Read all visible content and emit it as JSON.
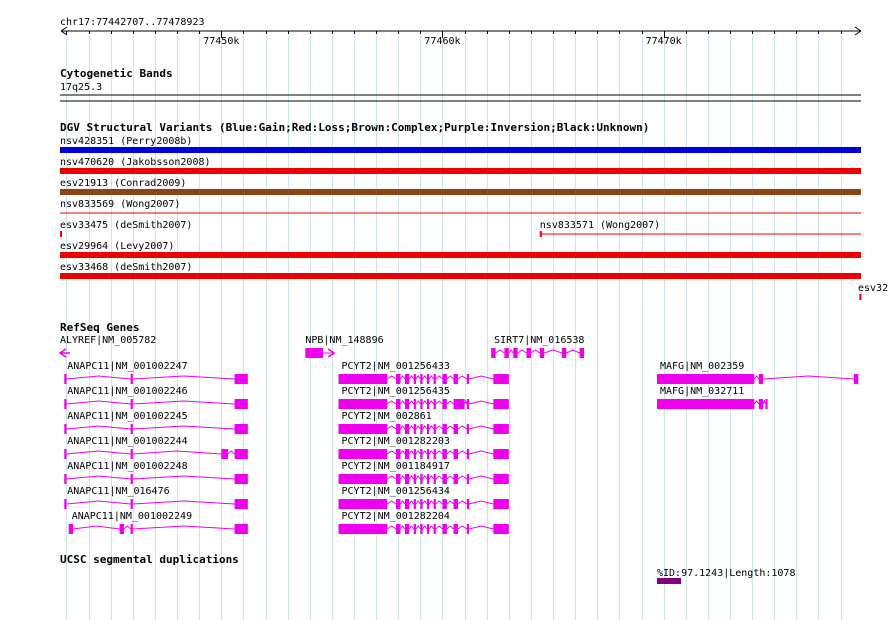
{
  "ruler": {
    "location": "chr17:77442707..77478923",
    "ticks": [
      {
        "pos": 77450000,
        "label": "77450k"
      },
      {
        "pos": 77460000,
        "label": "77460k"
      },
      {
        "pos": 77470000,
        "label": "77470k"
      }
    ],
    "minor_tick_step": 1000
  },
  "tracks": {
    "cytoband": {
      "title": "Cytogenetic Bands",
      "band": "17q25.3"
    },
    "dgv": {
      "title": "DGV Structural Variants (Blue:Gain;Red:Loss;Brown:Complex;Purple:Inversion;Black:Unknown)",
      "colors": {
        "gain": "#0000dd",
        "loss": "#ee0000",
        "complex": "#8b4513"
      },
      "features": [
        {
          "label": "nsv428351 (Perry2008b)",
          "type": "gain",
          "start": 77442707,
          "end": 77478923,
          "thick": true
        },
        {
          "label": "nsv470620 (Jakobsson2008)",
          "type": "loss",
          "start": 77442707,
          "end": 77478923,
          "thick": true
        },
        {
          "label": "esv21913 (Conrad2009)",
          "type": "complex",
          "start": 77442707,
          "end": 77478923,
          "thick": true
        },
        {
          "label": "nsv833569 (Wong2007)",
          "type": "loss",
          "start": 77442707,
          "end": 77478923,
          "thick": false
        },
        {
          "label": "esv33475 (deSmith2007)",
          "type": "loss",
          "start": 77442707,
          "end": 77442730,
          "thick": false,
          "tick": true
        },
        {
          "label": "nsv833571 (Wong2007)",
          "type": "loss",
          "start": 77464400,
          "end": 77478923,
          "thick": false
        },
        {
          "label": "esv29964 (Levy2007)",
          "type": "loss",
          "start": 77442707,
          "end": 77478923,
          "thick": true
        },
        {
          "label": "esv33468 (deSmith2007)",
          "type": "loss",
          "start": 77442707,
          "end": 77478923,
          "thick": true
        },
        {
          "label": "esv32",
          "type": "loss",
          "start": 77478850,
          "end": 77478923,
          "thick": false,
          "tick": true
        }
      ]
    },
    "refseq": {
      "title": "RefSeq Genes",
      "color": "#ee00ee",
      "genes": [
        {
          "label": "ALYREF|NM_005782",
          "start": 77442707,
          "end": 77442760,
          "strand": "-",
          "blocks": [],
          "arrow": true
        },
        {
          "label": "NPB|NM_148896",
          "start": 77453800,
          "end": 77455100,
          "strand": "+",
          "blocks": [
            [
              77453800,
              77454600
            ]
          ],
          "arrow": true
        },
        {
          "label": "SIRT7|NM_016538",
          "start": 77462200,
          "end": 77466400,
          "strand": "-",
          "blocks": [
            [
              77462200,
              77462400
            ],
            [
              77462800,
              77463000
            ],
            [
              77463200,
              77463400
            ],
            [
              77463800,
              77464000
            ],
            [
              77464400,
              77464600
            ],
            [
              77465400,
              77465600
            ],
            [
              77466200,
              77466400
            ]
          ]
        },
        {
          "label": "ANAPC11|NM_001002247",
          "start": 77442900,
          "end": 77451200,
          "strand": "+",
          "blocks": [
            [
              77442900,
              77443000
            ],
            [
              77445900,
              77446000
            ],
            [
              77450600,
              77451200
            ]
          ]
        },
        {
          "label": "ANAPC11|NM_001002246",
          "start": 77442900,
          "end": 77451200,
          "strand": "+",
          "blocks": [
            [
              77442900,
              77443000
            ],
            [
              77445900,
              77446000
            ],
            [
              77450600,
              77451200
            ]
          ]
        },
        {
          "label": "ANAPC11|NM_001002245",
          "start": 77442900,
          "end": 77451200,
          "strand": "+",
          "blocks": [
            [
              77442900,
              77443000
            ],
            [
              77445900,
              77446000
            ],
            [
              77450600,
              77451200
            ]
          ]
        },
        {
          "label": "ANAPC11|NM_001002244",
          "start": 77442900,
          "end": 77451200,
          "strand": "+",
          "blocks": [
            [
              77442900,
              77443000
            ],
            [
              77445900,
              77446000
            ],
            [
              77450000,
              77450300
            ],
            [
              77450600,
              77451200
            ]
          ]
        },
        {
          "label": "ANAPC11|NM_001002248",
          "start": 77442900,
          "end": 77451200,
          "strand": "+",
          "blocks": [
            [
              77442900,
              77443000
            ],
            [
              77445900,
              77446000
            ],
            [
              77450600,
              77451200
            ]
          ]
        },
        {
          "label": "ANAPC11|NM_016476",
          "start": 77442900,
          "end": 77451200,
          "strand": "+",
          "blocks": [
            [
              77442900,
              77443000
            ],
            [
              77445900,
              77446000
            ],
            [
              77450600,
              77451200
            ]
          ]
        },
        {
          "label": "ANAPC11|NM_001002249",
          "start": 77443100,
          "end": 77451200,
          "strand": "+",
          "blocks": [
            [
              77443100,
              77443300
            ],
            [
              77445400,
              77445600
            ],
            [
              77445900,
              77446000
            ],
            [
              77450600,
              77451200
            ]
          ]
        },
        {
          "label": "PCYT2|NM_001256433",
          "start": 77455300,
          "end": 77463000,
          "strand": "-",
          "blocks": [
            [
              77455300,
              77457500
            ],
            [
              77457900,
              77458100
            ],
            [
              77458300,
              77458500
            ],
            [
              77458700,
              77458800
            ],
            [
              77459000,
              77459100
            ],
            [
              77459300,
              77459400
            ],
            [
              77459600,
              77459700
            ],
            [
              77460000,
              77460200
            ],
            [
              77460500,
              77460700
            ],
            [
              77461100,
              77461200
            ],
            [
              77462300,
              77463000
            ]
          ]
        },
        {
          "label": "PCYT2|NM_001256435",
          "start": 77455300,
          "end": 77463000,
          "strand": "-",
          "blocks": [
            [
              77455300,
              77457500
            ],
            [
              77457900,
              77458100
            ],
            [
              77458300,
              77458500
            ],
            [
              77458700,
              77458800
            ],
            [
              77459000,
              77459100
            ],
            [
              77459300,
              77459400
            ],
            [
              77459600,
              77459700
            ],
            [
              77460000,
              77460200
            ],
            [
              77460500,
              77461000
            ],
            [
              77461100,
              77461200
            ],
            [
              77462300,
              77463000
            ]
          ]
        },
        {
          "label": "PCYT2|NM_002861",
          "start": 77455300,
          "end": 77463000,
          "strand": "-",
          "blocks": [
            [
              77455300,
              77457500
            ],
            [
              77457900,
              77458100
            ],
            [
              77458300,
              77458500
            ],
            [
              77458700,
              77458800
            ],
            [
              77459000,
              77459100
            ],
            [
              77459300,
              77459400
            ],
            [
              77459600,
              77459700
            ],
            [
              77460000,
              77460200
            ],
            [
              77460500,
              77460700
            ],
            [
              77461100,
              77461200
            ],
            [
              77462300,
              77463000
            ]
          ]
        },
        {
          "label": "PCYT2|NM_001282203",
          "start": 77455300,
          "end": 77463000,
          "strand": "-",
          "blocks": [
            [
              77455300,
              77457500
            ],
            [
              77457900,
              77458100
            ],
            [
              77458300,
              77458500
            ],
            [
              77458700,
              77458800
            ],
            [
              77459000,
              77459100
            ],
            [
              77459300,
              77459400
            ],
            [
              77459600,
              77459700
            ],
            [
              77460000,
              77460200
            ],
            [
              77460500,
              77460700
            ],
            [
              77461100,
              77461200
            ],
            [
              77462300,
              77463000
            ]
          ]
        },
        {
          "label": "PCYT2|NM_001184917",
          "start": 77455300,
          "end": 77463000,
          "strand": "-",
          "blocks": [
            [
              77455300,
              77457500
            ],
            [
              77457900,
              77458100
            ],
            [
              77458300,
              77458500
            ],
            [
              77458700,
              77458800
            ],
            [
              77459000,
              77459100
            ],
            [
              77459300,
              77459400
            ],
            [
              77459600,
              77459700
            ],
            [
              77460000,
              77460200
            ],
            [
              77460500,
              77460700
            ],
            [
              77461100,
              77461200
            ],
            [
              77462300,
              77463000
            ]
          ]
        },
        {
          "label": "PCYT2|NM_001256434",
          "start": 77455300,
          "end": 77463000,
          "strand": "-",
          "blocks": [
            [
              77455300,
              77457500
            ],
            [
              77457900,
              77458100
            ],
            [
              77458300,
              77458500
            ],
            [
              77458700,
              77458800
            ],
            [
              77459000,
              77459100
            ],
            [
              77459300,
              77459400
            ],
            [
              77459600,
              77459700
            ],
            [
              77460000,
              77460200
            ],
            [
              77460500,
              77460700
            ],
            [
              77461100,
              77461200
            ],
            [
              77462300,
              77463000
            ]
          ]
        },
        {
          "label": "PCYT2|NM_001282204",
          "start": 77455300,
          "end": 77463000,
          "strand": "-",
          "blocks": [
            [
              77455300,
              77457500
            ],
            [
              77457900,
              77458100
            ],
            [
              77458300,
              77458500
            ],
            [
              77458700,
              77458800
            ],
            [
              77459000,
              77459100
            ],
            [
              77459300,
              77459400
            ],
            [
              77459600,
              77459700
            ],
            [
              77460000,
              77460200
            ],
            [
              77460500,
              77460700
            ],
            [
              77461100,
              77461200
            ],
            [
              77462300,
              77463000
            ]
          ]
        },
        {
          "label": "MAFG|NM_002359",
          "start": 77469700,
          "end": 77478800,
          "strand": "-",
          "blocks": [
            [
              77469700,
              77474100
            ],
            [
              77474300,
              77474500
            ],
            [
              77478600,
              77478800
            ]
          ]
        },
        {
          "label": "MAFG|NM_032711",
          "start": 77469700,
          "end": 77474700,
          "strand": "-",
          "blocks": [
            [
              77469700,
              77474100
            ],
            [
              77474300,
              77474500
            ],
            [
              77474600,
              77474700
            ]
          ]
        }
      ]
    },
    "segdup": {
      "title": "UCSC segmental duplications",
      "color": "#800080",
      "features": [
        {
          "label": "%ID:97.1243|Length:1078",
          "start": 77469700,
          "end": 77470778
        }
      ]
    }
  }
}
